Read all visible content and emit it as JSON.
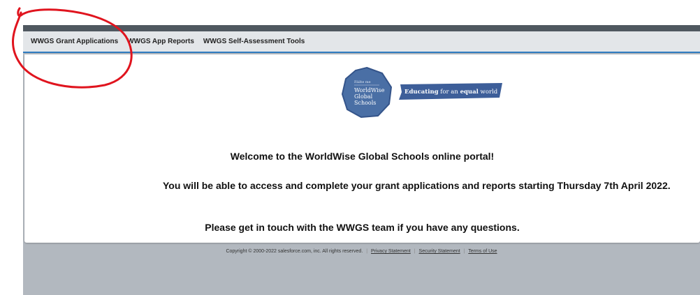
{
  "tabs": [
    {
      "label": "WWGS Grant Applications"
    },
    {
      "label": "WWGS App Reports"
    },
    {
      "label": "WWGS Self-Assessment Tools"
    }
  ],
  "logo": {
    "seal_small": "Fáilte me",
    "seal_line1": "WorldWise",
    "seal_line2": "Global",
    "seal_line3": "Schools",
    "banner_bold1": "Educating",
    "banner_mid": " for an ",
    "banner_bold2": "equal",
    "banner_end": " world"
  },
  "messages": {
    "welcome": "Welcome to the WorldWise Global Schools online portal!",
    "access": "You will be able to access and complete your grant applications and reports starting Thursday 7th April 2022.",
    "contact": "Please get in touch with the WWGS team if you have any questions."
  },
  "footer": {
    "copyright": "Copyright © 2000-2022 salesforce.com, inc. All rights reserved.",
    "privacy": "Privacy Statement",
    "security": "Security Statement",
    "terms": "Terms of Use"
  },
  "colors": {
    "annotation": "#e0141e",
    "tab_underline": "#2e7bbf",
    "seal_fill": "#4a6fa5",
    "banner_fill": "#3d5e99"
  }
}
